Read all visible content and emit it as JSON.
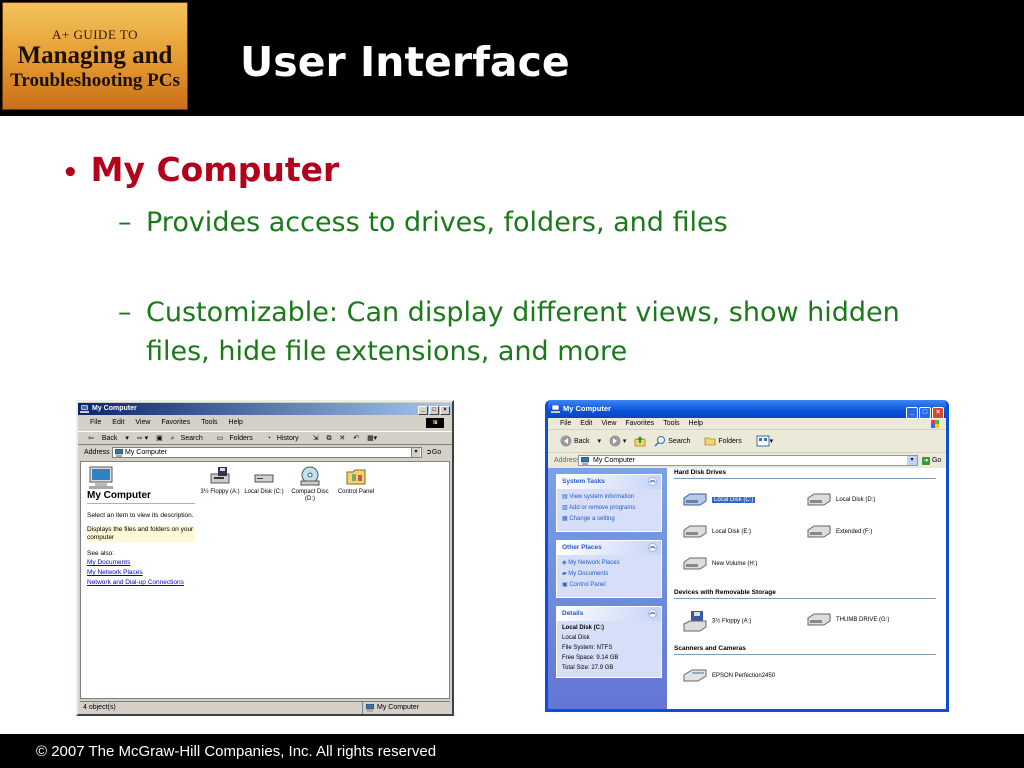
{
  "header": {
    "logo": {
      "line1": "A+ GUIDE TO",
      "line2": "Managing and",
      "line3": "Troubleshooting PCs"
    },
    "title": "User Interface"
  },
  "bullets": {
    "main": "My Computer",
    "sub1": "Provides access to drives, folders, and files",
    "sub2": "Customizable: Can display different views, show hidden files, hide file extensions, and more"
  },
  "win_classic": {
    "title": "My Computer",
    "menu": [
      "File",
      "Edit",
      "View",
      "Favorites",
      "Tools",
      "Help"
    ],
    "toolbar": {
      "back": "Back",
      "search": "Search",
      "folders": "Folders",
      "history": "History"
    },
    "address_label": "Address",
    "address_value": "My Computer",
    "go": "Go",
    "left": {
      "heading": "My Computer",
      "p1": "Select an item to view its description.",
      "p2": "Displays the files and folders on your computer",
      "see_also": "See also:",
      "links": [
        "My Documents",
        "My Network Places",
        "Network and Dial-up Connections"
      ]
    },
    "drives": [
      "3½ Floppy (A:)",
      "Local Disk (C:)",
      "Compact Disc (D:)",
      "Control Panel"
    ],
    "status_left": "4 object(s)",
    "status_right": "My Computer"
  },
  "win_xp": {
    "title": "My Computer",
    "menu": [
      "File",
      "Edit",
      "View",
      "Favorites",
      "Tools",
      "Help"
    ],
    "toolbar": {
      "back": "Back",
      "search": "Search",
      "folders": "Folders"
    },
    "address_label": "Address",
    "address_value": "My Computer",
    "go": "Go",
    "system_tasks": {
      "heading": "System Tasks",
      "items": [
        "View system information",
        "Add or remove programs",
        "Change a setting"
      ]
    },
    "other_places": {
      "heading": "Other Places",
      "items": [
        "My Network Places",
        "My Documents",
        "Control Panel"
      ]
    },
    "details": {
      "heading": "Details",
      "name": "Local Disk (C:)",
      "type": "Local Disk",
      "fs": "File System: NTFS",
      "free": "Free Space: 9.14 GB",
      "total": "Total Size: 27.9 GB"
    },
    "groups": {
      "hdd": "Hard Disk Drives",
      "removable": "Devices with Removable Storage",
      "scanners": "Scanners and Cameras"
    },
    "hdd_items": [
      "Local Disk (C:)",
      "Local Disk (D:)",
      "Local Disk (E:)",
      "Extended (F:)",
      "New Volume (H:)"
    ],
    "removable_items": [
      "3½ Floppy (A:)",
      "THUMB DRIVE (G:)"
    ],
    "scanner_items": [
      "EPSON Perfection2450"
    ]
  },
  "footer": "© 2007 The McGraw-Hill Companies, Inc. All rights reserved"
}
